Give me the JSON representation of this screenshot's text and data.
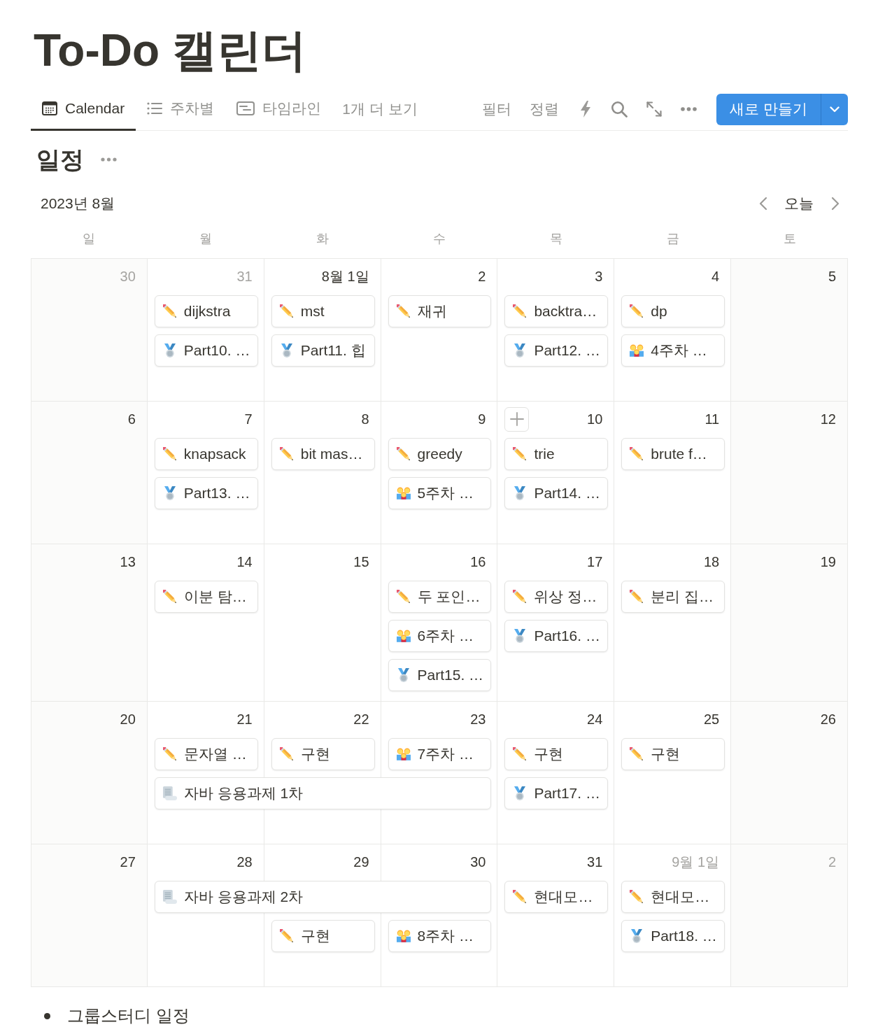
{
  "page": {
    "title": "To-Do 캘린더"
  },
  "views": {
    "tabs": [
      {
        "label": "Calendar",
        "kind": "calendar",
        "selected": true
      },
      {
        "label": "주차별",
        "kind": "list",
        "selected": false
      },
      {
        "label": "타임라인",
        "kind": "timeline",
        "selected": false
      }
    ],
    "more": "1개 더 보기"
  },
  "toolbar": {
    "filter": "필터",
    "sort": "정렬",
    "new_button": "새로 만들기"
  },
  "calendar": {
    "title": "일정",
    "month": "2023년 8월",
    "today": "오늘",
    "weekdays": [
      "일",
      "월",
      "화",
      "수",
      "목",
      "금",
      "토"
    ],
    "weeks": [
      {
        "days": [
          {
            "date": "30",
            "muted": true,
            "hovered": false
          },
          {
            "date": "31",
            "muted": true,
            "hovered": false,
            "events": [
              {
                "kind": "task",
                "title": "dijkstra"
              },
              {
                "kind": "lecture",
                "title": "Part10. …"
              }
            ]
          },
          {
            "date": "8월 1일",
            "muted": false,
            "hovered": false,
            "events": [
              {
                "kind": "task",
                "title": "mst"
              },
              {
                "kind": "lecture",
                "title": "Part11. 힙"
              }
            ]
          },
          {
            "date": "2",
            "muted": false,
            "hovered": false,
            "events": [
              {
                "kind": "task",
                "title": "재귀"
              }
            ]
          },
          {
            "date": "3",
            "muted": false,
            "hovered": false,
            "events": [
              {
                "kind": "task",
                "title": "backtra…"
              },
              {
                "kind": "lecture",
                "title": "Part12. …"
              }
            ]
          },
          {
            "date": "4",
            "muted": false,
            "hovered": false,
            "events": [
              {
                "kind": "task",
                "title": "dp"
              },
              {
                "kind": "study",
                "title": "4주차 …"
              }
            ]
          },
          {
            "date": "5",
            "muted": false,
            "hovered": false
          }
        ]
      },
      {
        "days": [
          {
            "date": "6",
            "muted": false,
            "hovered": false
          },
          {
            "date": "7",
            "muted": false,
            "hovered": false,
            "events": [
              {
                "kind": "task",
                "title": "knapsack"
              },
              {
                "kind": "lecture",
                "title": "Part13. …"
              }
            ]
          },
          {
            "date": "8",
            "muted": false,
            "hovered": false,
            "events": [
              {
                "kind": "task",
                "title": "bit mas…"
              }
            ]
          },
          {
            "date": "9",
            "muted": false,
            "hovered": false,
            "events": [
              {
                "kind": "task",
                "title": "greedy"
              },
              {
                "kind": "study",
                "title": "5주차 …"
              }
            ]
          },
          {
            "date": "10",
            "muted": false,
            "hovered": true,
            "events": [
              {
                "kind": "task",
                "title": "trie"
              },
              {
                "kind": "lecture",
                "title": "Part14. …"
              }
            ]
          },
          {
            "date": "11",
            "muted": false,
            "hovered": false,
            "events": [
              {
                "kind": "task",
                "title": "brute f…"
              }
            ]
          },
          {
            "date": "12",
            "muted": false,
            "hovered": false
          }
        ]
      },
      {
        "days": [
          {
            "date": "13",
            "muted": false,
            "hovered": false
          },
          {
            "date": "14",
            "muted": false,
            "hovered": false,
            "events": [
              {
                "kind": "task",
                "title": "이분 탐…"
              }
            ]
          },
          {
            "date": "15",
            "muted": false,
            "hovered": false
          },
          {
            "date": "16",
            "muted": false,
            "hovered": false,
            "events": [
              {
                "kind": "task",
                "title": "두 포인…"
              },
              {
                "kind": "study",
                "title": "6주차 …"
              },
              {
                "kind": "lecture",
                "title": "Part15. …"
              }
            ]
          },
          {
            "date": "17",
            "muted": false,
            "hovered": false,
            "events": [
              {
                "kind": "task",
                "title": "위상 정…"
              },
              {
                "kind": "lecture",
                "title": "Part16. …"
              }
            ]
          },
          {
            "date": "18",
            "muted": false,
            "hovered": false,
            "events": [
              {
                "kind": "task",
                "title": "분리 집…"
              }
            ]
          },
          {
            "date": "19",
            "muted": false,
            "hovered": false
          }
        ]
      },
      {
        "days": [
          {
            "date": "20",
            "muted": false,
            "hovered": false
          },
          {
            "date": "21",
            "muted": false,
            "hovered": false,
            "events": [
              {
                "kind": "task",
                "title": "문자열 …"
              },
              {
                "kind": "assignment",
                "title": "자바 응용과제 1차"
              }
            ]
          },
          {
            "date": "22",
            "muted": false,
            "hovered": false,
            "events": [
              {
                "kind": "task",
                "title": "구현"
              },
              {
                "kind": "continuation"
              }
            ]
          },
          {
            "date": "23",
            "muted": false,
            "hovered": false,
            "events": [
              {
                "kind": "study",
                "title": "7주차 …"
              },
              {
                "kind": "continuation"
              }
            ]
          },
          {
            "date": "24",
            "muted": false,
            "hovered": false,
            "events": [
              {
                "kind": "task",
                "title": "구현"
              },
              {
                "kind": "lecture",
                "title": "Part17. …"
              }
            ]
          },
          {
            "date": "25",
            "muted": false,
            "hovered": false,
            "events": [
              {
                "kind": "task",
                "title": "구현"
              }
            ]
          },
          {
            "date": "26",
            "muted": false,
            "hovered": false
          }
        ]
      },
      {
        "days": [
          {
            "date": "27",
            "muted": false,
            "hovered": false
          },
          {
            "date": "28",
            "muted": false,
            "hovered": false,
            "events": [
              {
                "kind": "assignment",
                "title": "자바 응용과제 2차"
              }
            ]
          },
          {
            "date": "29",
            "muted": false,
            "hovered": false,
            "events": [
              {
                "kind": "continuation"
              },
              {
                "kind": "task",
                "title": "구현"
              }
            ]
          },
          {
            "date": "30",
            "muted": false,
            "hovered": false,
            "events": [
              {
                "kind": "continuation"
              },
              {
                "kind": "study",
                "title": "8주차 …"
              }
            ]
          },
          {
            "date": "31",
            "muted": false,
            "hovered": false,
            "events": [
              {
                "kind": "task",
                "title": "현대모…"
              }
            ]
          },
          {
            "date": "9월 1일",
            "muted": true,
            "hovered": false,
            "events": [
              {
                "kind": "task",
                "title": "현대모…"
              },
              {
                "kind": "lecture",
                "title": "Part18. …"
              }
            ]
          },
          {
            "date": "2",
            "muted": true,
            "hovered": false
          }
        ]
      }
    ]
  },
  "footer": {
    "bullets": [
      "그룹스터디 일정"
    ]
  }
}
